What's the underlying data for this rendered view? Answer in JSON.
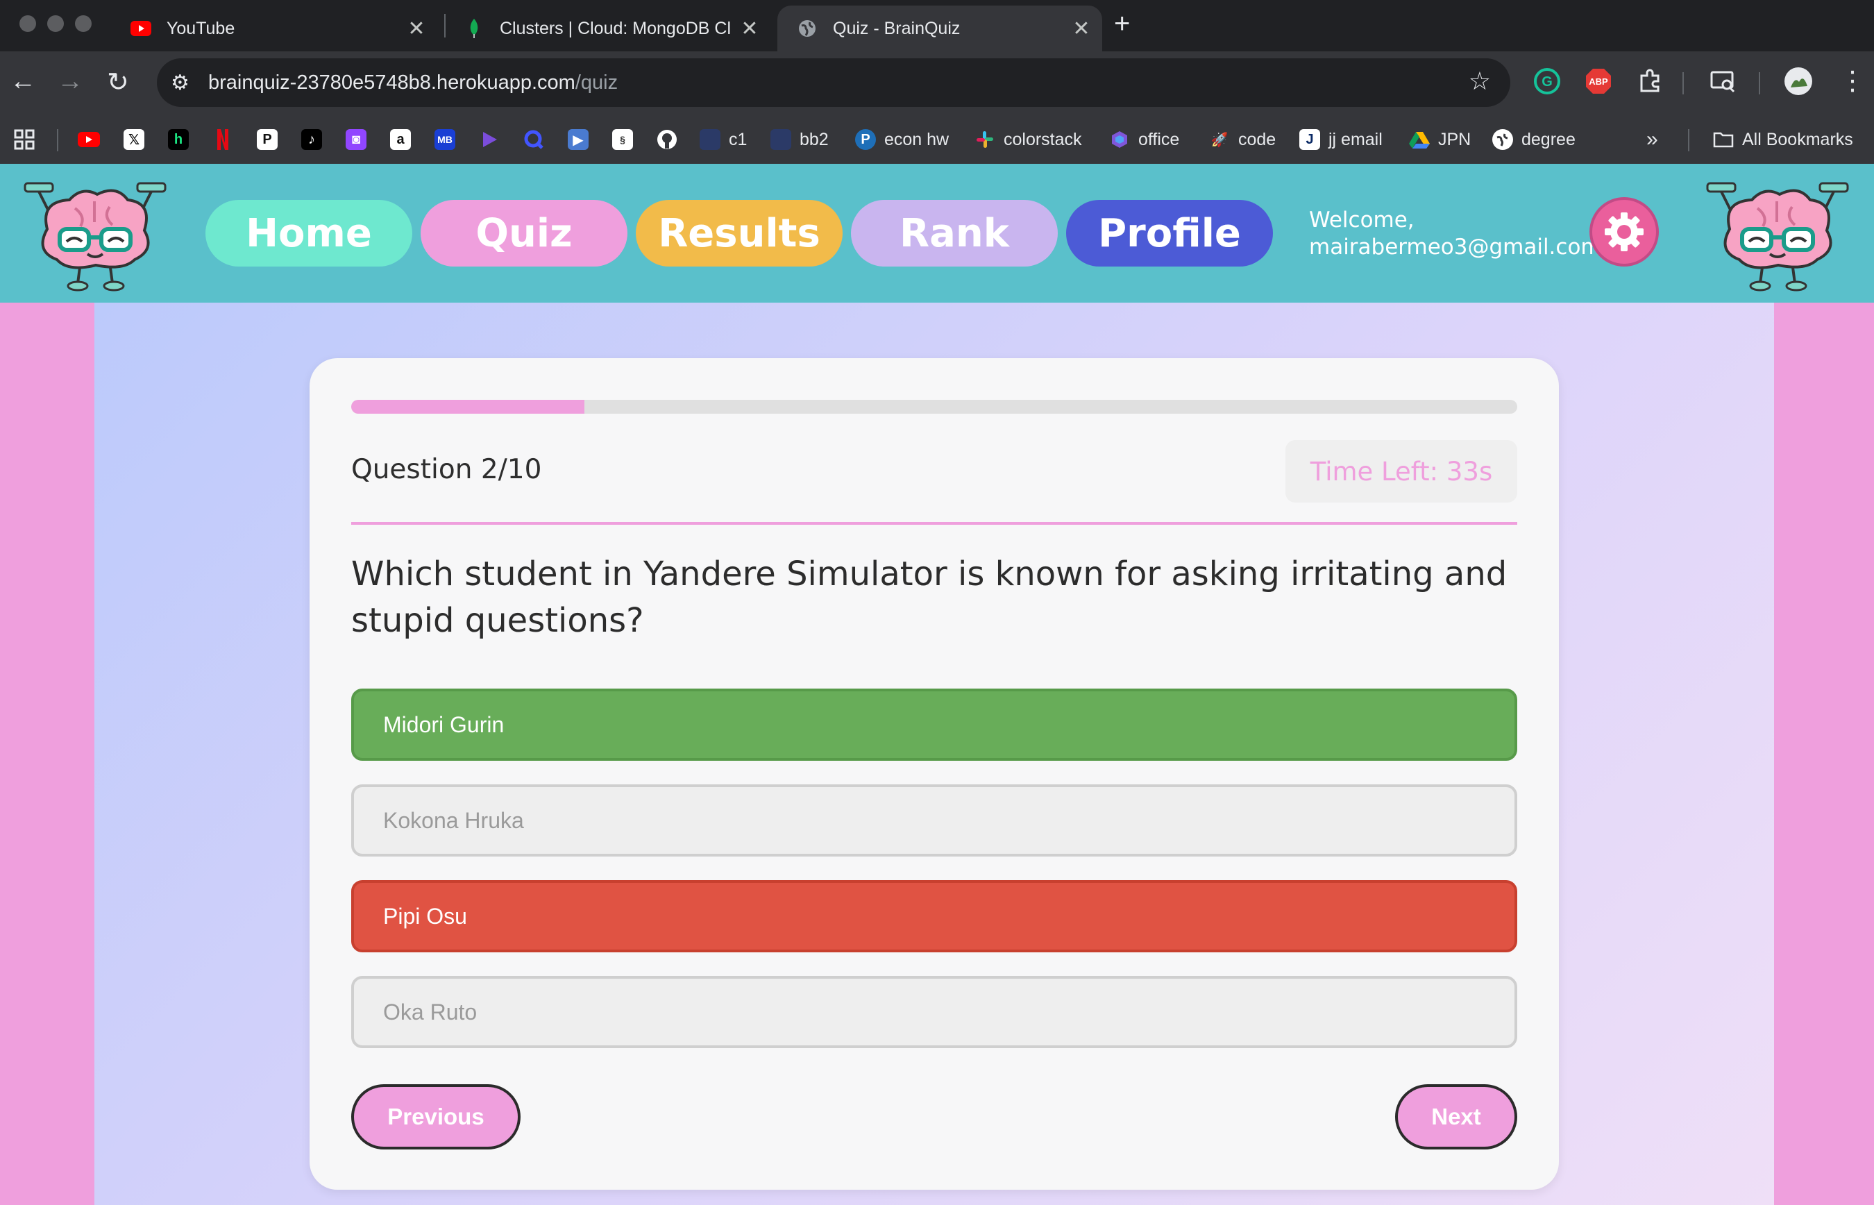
{
  "browser": {
    "tabs": [
      {
        "title": "YouTube",
        "icon": "youtube-icon",
        "active": false
      },
      {
        "title": "Clusters | Cloud: MongoDB Cl",
        "icon": "mongodb-leaf-icon",
        "active": false
      },
      {
        "title": "Quiz - BrainQuiz",
        "icon": "globe-icon",
        "active": true
      }
    ],
    "url_host": "brainquiz-23780e5748b8.herokuapp.com",
    "url_path": "/quiz",
    "bookmarks": [
      {
        "label": "c1",
        "icon": "folder-icon"
      },
      {
        "label": "bb2",
        "icon": "folder-icon"
      },
      {
        "label": "econ hw",
        "icon": "pearson-icon"
      },
      {
        "label": "colorstack",
        "icon": "slack-icon"
      },
      {
        "label": "office",
        "icon": "office-icon"
      },
      {
        "label": "code",
        "icon": "rocket-icon"
      },
      {
        "label": "jj email",
        "icon": "j-icon"
      },
      {
        "label": "JPN",
        "icon": "drive-icon"
      },
      {
        "label": "degree",
        "icon": "globe-icon"
      }
    ],
    "all_bookmarks_label": "All Bookmarks",
    "bookmark_icon_labels": {
      "hulu": "h",
      "pinterest": "P",
      "amazon": "a",
      "mb": "MB",
      "ext_abp": "ABP"
    }
  },
  "header": {
    "nav": [
      {
        "label": "Home",
        "color": "#6ee8cf"
      },
      {
        "label": "Quiz",
        "color": "#ef9fdd"
      },
      {
        "label": "Results",
        "color": "#f2bb4a"
      },
      {
        "label": "Rank",
        "color": "#c9b5ef"
      },
      {
        "label": "Profile",
        "color": "#4c5bd6"
      }
    ],
    "welcome_line1": "Welcome,",
    "welcome_email": "mairabermeo3@gmail.com"
  },
  "quiz": {
    "question_counter": "Question 2/10",
    "progress_fraction": 0.2,
    "time_left": "Time Left: 33s",
    "question": "Which student in Yandere Simulator is known for asking irritating and stupid questions?",
    "options": [
      {
        "label": "Midori Gurin",
        "state": "correct"
      },
      {
        "label": "Kokona Hruka",
        "state": "neutral"
      },
      {
        "label": "Pipi Osu",
        "state": "wrong"
      },
      {
        "label": "Oka Ruto",
        "state": "neutral"
      }
    ],
    "prev_label": "Previous",
    "next_label": "Next"
  },
  "colors": {
    "header_bg": "#5ac0cb",
    "accent_pink": "#ef9fdd",
    "correct": "#68ad59",
    "wrong": "#e05343"
  }
}
